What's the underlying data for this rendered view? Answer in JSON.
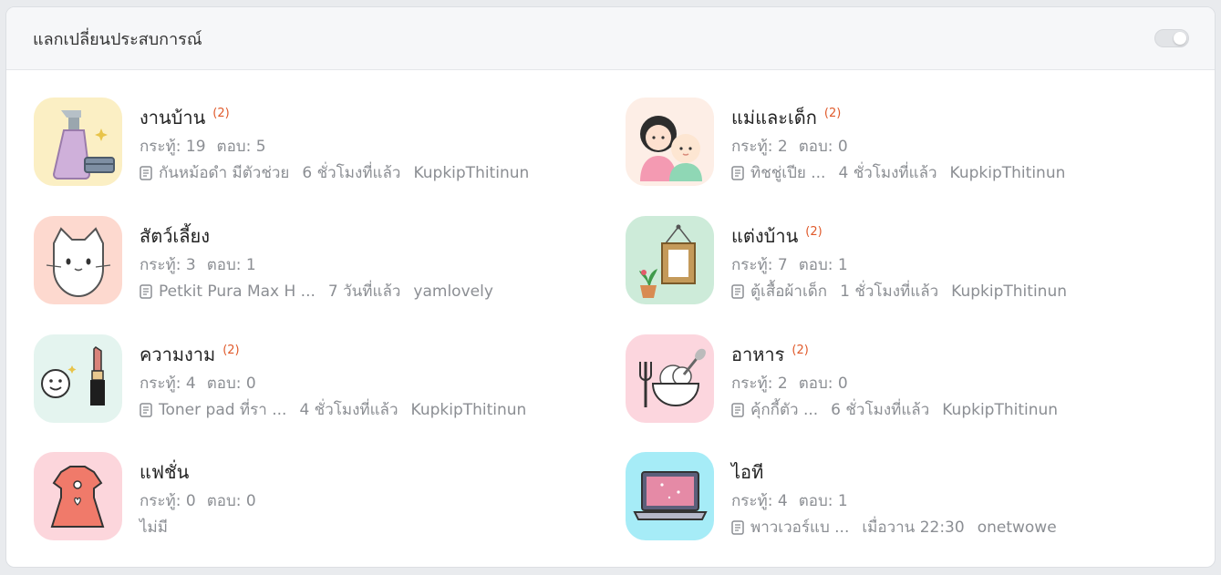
{
  "header": {
    "title": "แลกเปลี่ยนประสบการณ์"
  },
  "categories": [
    {
      "name": "งานบ้าน",
      "badge": "(2)",
      "threads": "กระทู้: 19",
      "replies": "ตอบ: 5",
      "topic": "กันหม้อดำ มีตัวช่วย",
      "time": "6 ชั่วโมงที่แล้ว",
      "user": "KupkipThitinun",
      "bg": "#fbefc4"
    },
    {
      "name": "แม่และเด็ก",
      "badge": "(2)",
      "threads": "กระทู้: 2",
      "replies": "ตอบ: 0",
      "topic": "ทิชชู่เปีย ...",
      "time": "4 ชั่วโมงที่แล้ว",
      "user": "KupkipThitinun",
      "bg": "#fdeee6"
    },
    {
      "name": "สัตว์เลี้ยง",
      "badge": "",
      "threads": "กระทู้: 3",
      "replies": "ตอบ: 1",
      "topic": "Petkit Pura Max H ...",
      "time": "7 วันที่แล้ว",
      "user": "yamlovely",
      "bg": "#fdd9cf"
    },
    {
      "name": "แต่งบ้าน",
      "badge": "(2)",
      "threads": "กระทู้: 7",
      "replies": "ตอบ: 1",
      "topic": "ตู้เสื้อผ้าเด็ก",
      "time": "1 ชั่วโมงที่แล้ว",
      "user": "KupkipThitinun",
      "bg": "#cdebd9"
    },
    {
      "name": "ความงาม",
      "badge": "(2)",
      "threads": "กระทู้: 4",
      "replies": "ตอบ: 0",
      "topic": "Toner pad ที่รา ...",
      "time": "4 ชั่วโมงที่แล้ว",
      "user": "KupkipThitinun",
      "bg": "#e4f4ef"
    },
    {
      "name": "อาหาร",
      "badge": "(2)",
      "threads": "กระทู้: 2",
      "replies": "ตอบ: 0",
      "topic": "คุ้กกี้ตัว ...",
      "time": "6 ชั่วโมงที่แล้ว",
      "user": "KupkipThitinun",
      "bg": "#fcd6de"
    },
    {
      "name": "แฟชั่น",
      "badge": "",
      "threads": "กระทู้: 0",
      "replies": "ตอบ: 0",
      "empty": "ไม่มี",
      "bg": "#fcd6dc"
    },
    {
      "name": "ไอที",
      "badge": "",
      "threads": "กระทู้: 4",
      "replies": "ตอบ: 1",
      "topic": "พาวเวอร์แบ ...",
      "time": "เมื่อวาน 22:30",
      "user": "onetwowe",
      "bg": "#a6ecf7"
    }
  ]
}
